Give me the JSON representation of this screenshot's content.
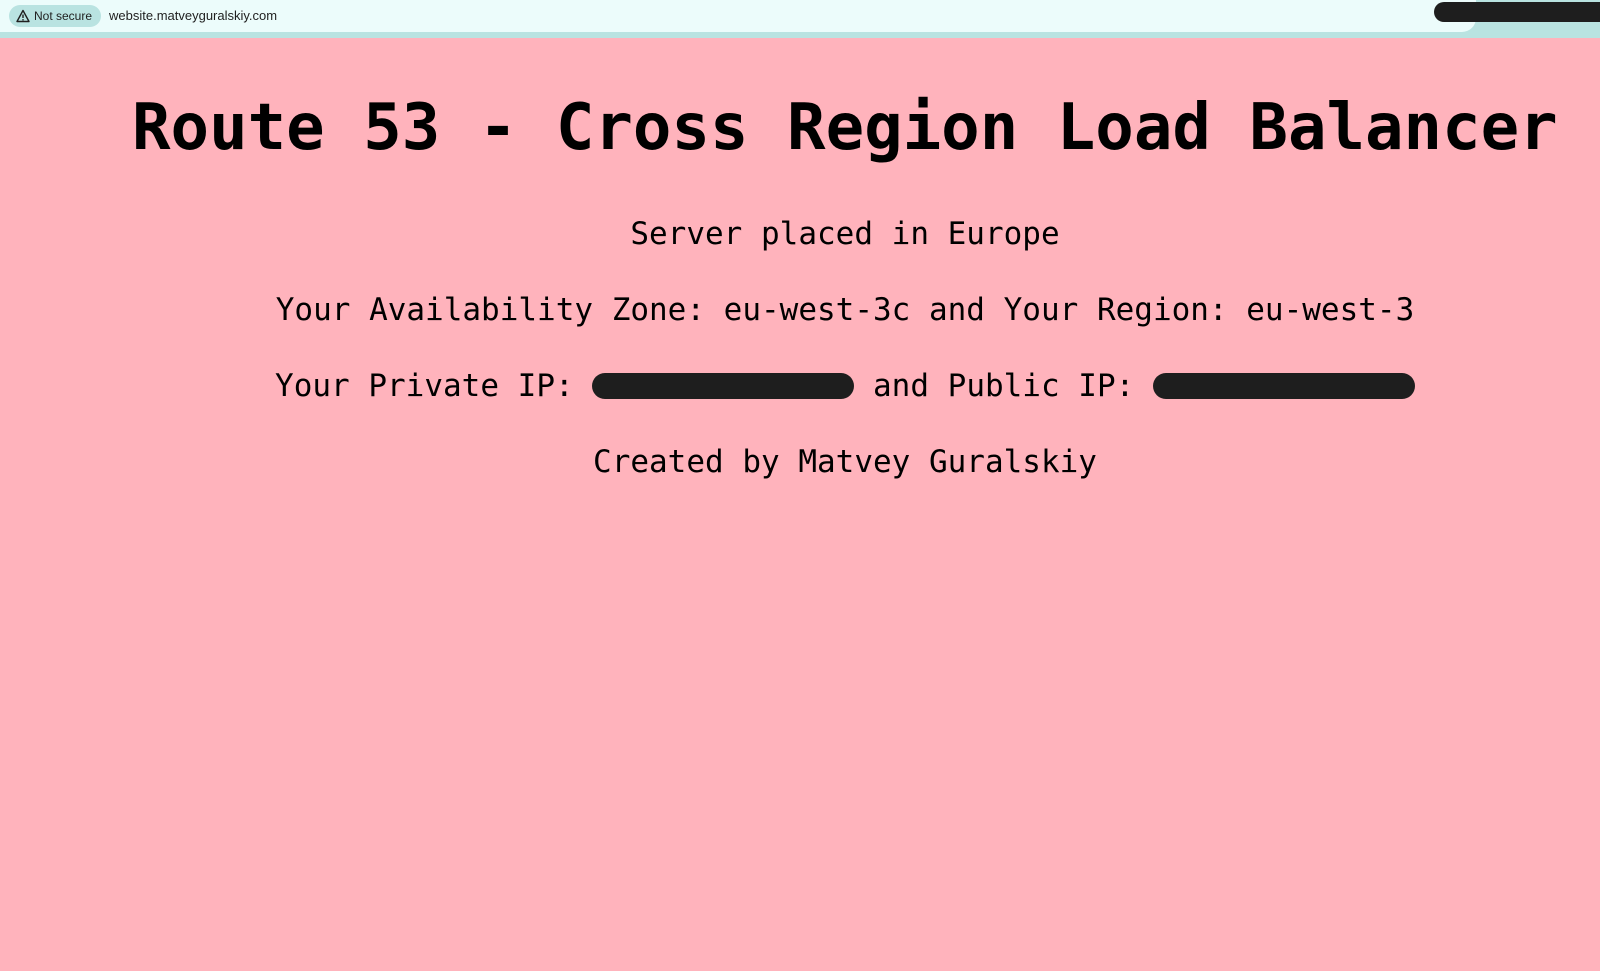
{
  "browser": {
    "security_label": "Not secure",
    "url": "website.matveyguralskiy.com"
  },
  "page": {
    "title": "Route 53 - Cross Region Load Balancer",
    "server_location": "Server placed in Europe",
    "zone_line": "Your Availability Zone: eu-west-3c and Your Region: eu-west-3",
    "private_ip_label": "Your Private IP:",
    "public_ip_label": "and Public IP:",
    "credit": "Created by Matvey Guralskiy"
  },
  "colors": {
    "page_background": "#ffb3bc",
    "toolbar_background": "#b9e3e1",
    "omnibox_background": "#ecfcfb",
    "redaction": "#1e1e1e"
  },
  "icons": {
    "security": "warning-triangle-icon"
  }
}
